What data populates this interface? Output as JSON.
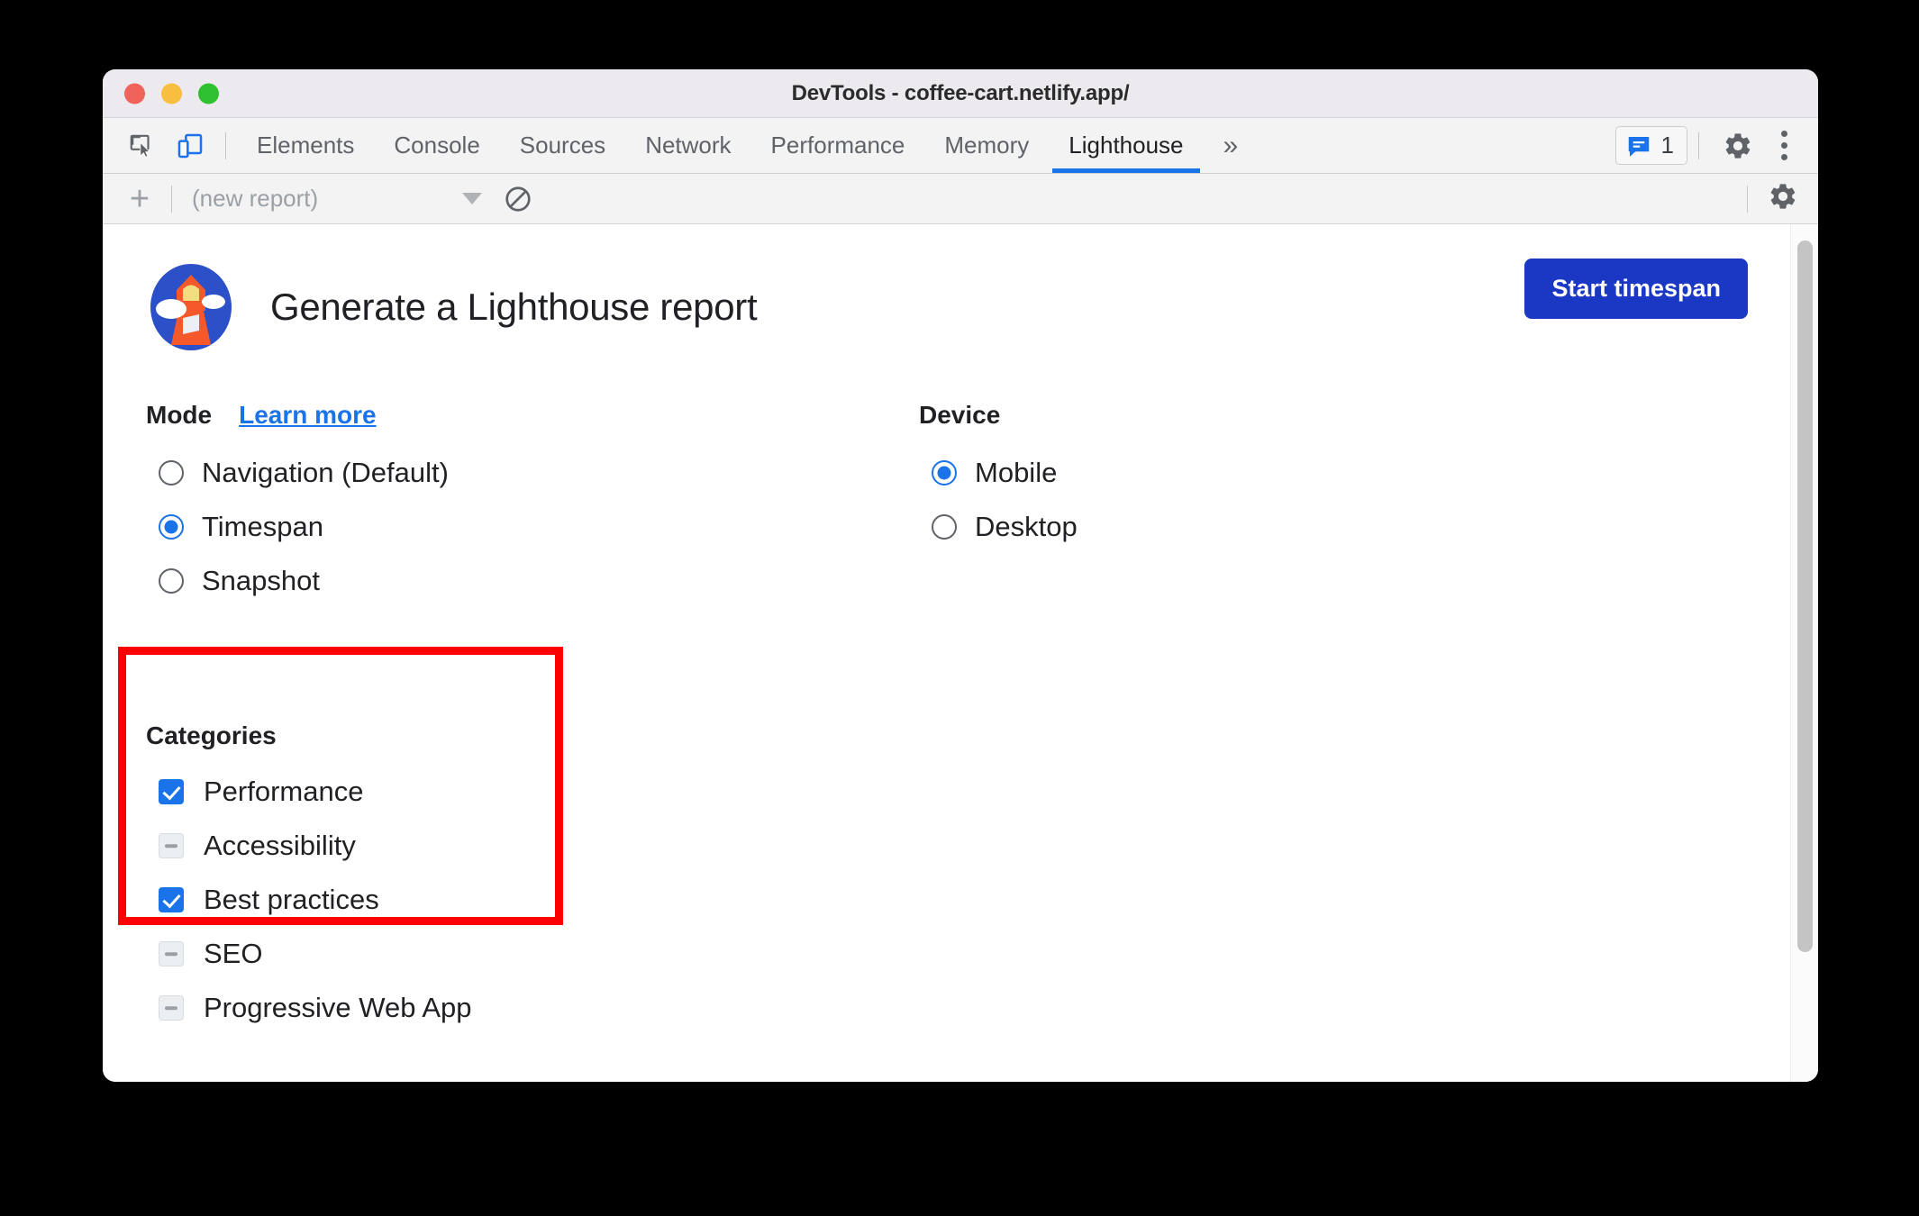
{
  "window": {
    "title": "DevTools - coffee-cart.netlify.app/",
    "traffic_lights": [
      {
        "name": "close",
        "color": "#f0635a"
      },
      {
        "name": "minimize",
        "color": "#f8be40"
      },
      {
        "name": "maximize",
        "color": "#2fc02f"
      }
    ]
  },
  "toolbar": {
    "inspect_icon": "inspect-element-icon",
    "device_toolbar_icon": "device-toggle-icon",
    "tabs": [
      {
        "label": "Elements",
        "active": false
      },
      {
        "label": "Console",
        "active": false
      },
      {
        "label": "Sources",
        "active": false
      },
      {
        "label": "Network",
        "active": false
      },
      {
        "label": "Performance",
        "active": false
      },
      {
        "label": "Memory",
        "active": false
      },
      {
        "label": "Lighthouse",
        "active": true
      }
    ],
    "more_tabs_label": "»",
    "issues_count": "1",
    "issues_icon": "issues-message-icon",
    "settings_icon": "gear-icon",
    "more_options_icon": "kebab-menu-icon",
    "accent": "#1a73e8"
  },
  "subtoolbar": {
    "add_label": "+",
    "report_value": "(new report)",
    "caret_icon": "chevron-down-icon",
    "clear_icon": "clear-all-icon",
    "settings_icon": "gear-icon"
  },
  "main": {
    "logo_icon": "lighthouse-logo-icon",
    "heading": "Generate a Lighthouse report",
    "start_button": "Start timespan",
    "mode": {
      "title": "Mode",
      "learn_more": "Learn more",
      "options": [
        {
          "label": "Navigation (Default)",
          "checked": false
        },
        {
          "label": "Timespan",
          "checked": true
        },
        {
          "label": "Snapshot",
          "checked": false
        }
      ]
    },
    "device": {
      "title": "Device",
      "options": [
        {
          "label": "Mobile",
          "checked": true
        },
        {
          "label": "Desktop",
          "checked": false
        }
      ]
    },
    "categories": {
      "title": "Categories",
      "items": [
        {
          "label": "Performance",
          "state": "checked"
        },
        {
          "label": "Accessibility",
          "state": "indeterminate"
        },
        {
          "label": "Best practices",
          "state": "checked"
        },
        {
          "label": "SEO",
          "state": "indeterminate"
        },
        {
          "label": "Progressive Web App",
          "state": "indeterminate"
        }
      ]
    },
    "highlight_color": "#fe0000"
  }
}
